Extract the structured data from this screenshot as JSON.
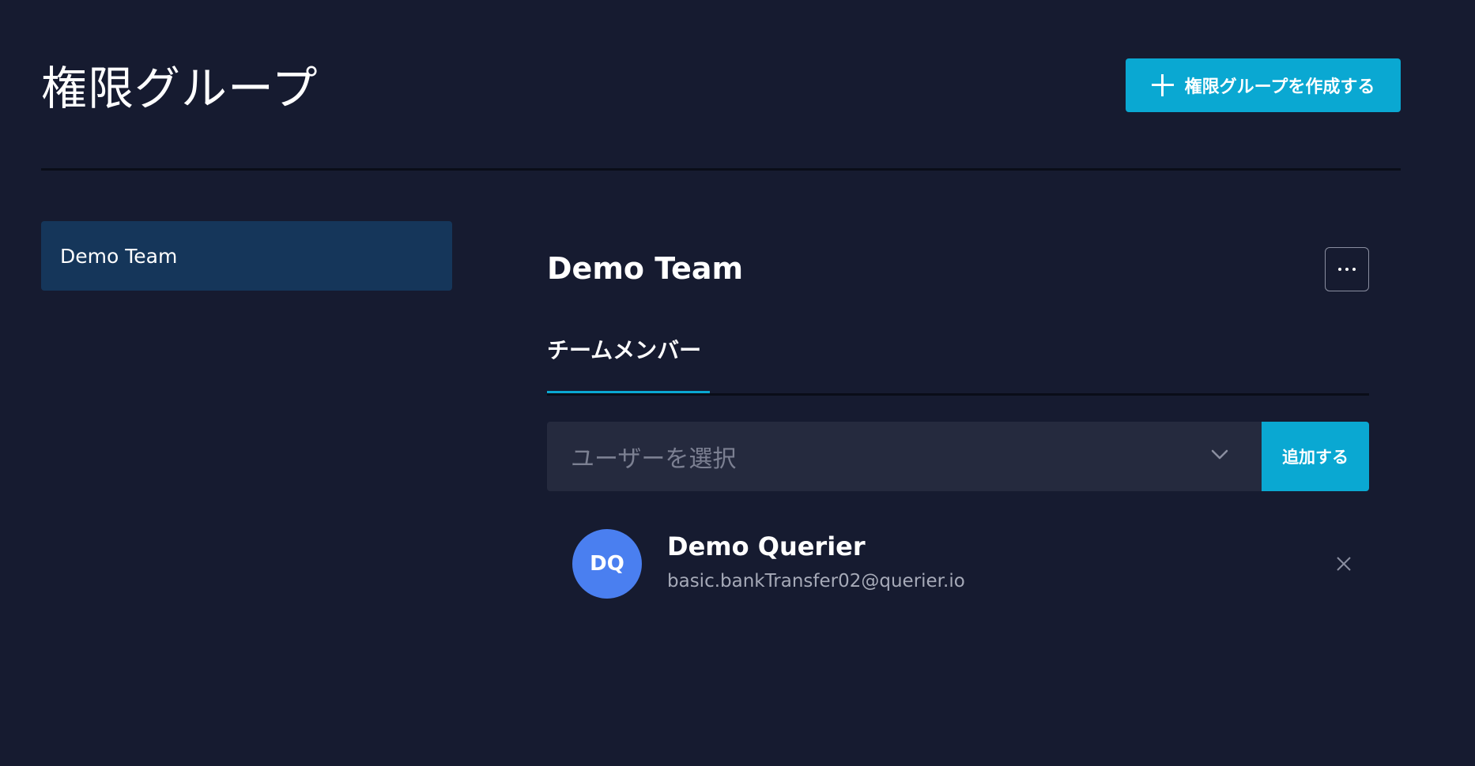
{
  "header": {
    "title": "権限グループ",
    "create_button_label": "権限グループを作成する"
  },
  "sidebar": {
    "items": [
      {
        "label": "Demo Team",
        "selected": true
      }
    ]
  },
  "group": {
    "title": "Demo Team",
    "tabs": [
      {
        "label": "チームメンバー",
        "active": true
      }
    ]
  },
  "member_picker": {
    "placeholder": "ユーザーを選択",
    "add_button_label": "追加する"
  },
  "members": [
    {
      "initials": "DQ",
      "name": "Demo Querier",
      "email": "basic.bankTransfer02@querier.io"
    }
  ],
  "colors": {
    "background": "#161b30",
    "accent": "#0aa8d2",
    "sidebar_selected": "#15365a",
    "avatar": "#4a7ff0",
    "select_background": "#252a3e"
  },
  "icons": {
    "create": "plus-icon",
    "more": "more-horizontal-icon",
    "dropdown": "chevron-down-icon",
    "remove": "close-icon"
  }
}
